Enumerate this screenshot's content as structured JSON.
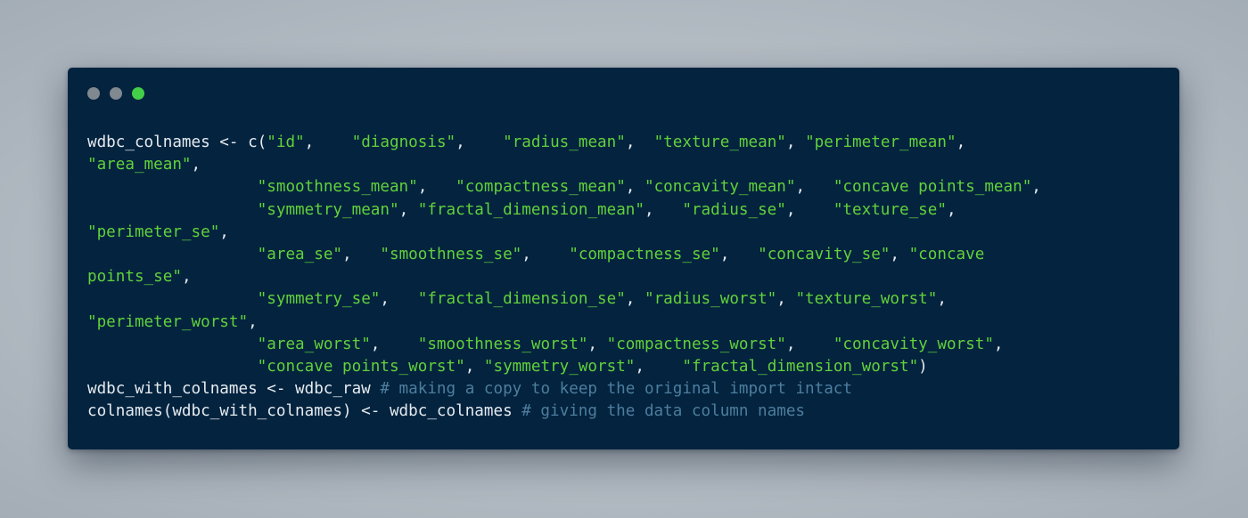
{
  "window": {
    "background": "#03233f",
    "buttons": [
      {
        "name": "close",
        "color": "#808890"
      },
      {
        "name": "minimize",
        "color": "#808890"
      },
      {
        "name": "maximize",
        "color": "#43cf47"
      }
    ]
  },
  "colors": {
    "plain": "#e6ebef",
    "string": "#62d13a",
    "comment": "#4d7e9e"
  },
  "code_lines": [
    [
      {
        "t": "plain",
        "v": "wdbc_colnames <- c("
      },
      {
        "t": "string",
        "v": "\"id\""
      },
      {
        "t": "plain",
        "v": ",    "
      },
      {
        "t": "string",
        "v": "\"diagnosis\""
      },
      {
        "t": "plain",
        "v": ",    "
      },
      {
        "t": "string",
        "v": "\"radius_mean\""
      },
      {
        "t": "plain",
        "v": ",  "
      },
      {
        "t": "string",
        "v": "\"texture_mean\""
      },
      {
        "t": "plain",
        "v": ", "
      },
      {
        "t": "string",
        "v": "\"perimeter_mean\""
      },
      {
        "t": "plain",
        "v": ","
      }
    ],
    [
      {
        "t": "string",
        "v": "\"area_mean\""
      },
      {
        "t": "plain",
        "v": ","
      }
    ],
    [
      {
        "t": "plain",
        "v": "                  "
      },
      {
        "t": "string",
        "v": "\"smoothness_mean\""
      },
      {
        "t": "plain",
        "v": ",   "
      },
      {
        "t": "string",
        "v": "\"compactness_mean\""
      },
      {
        "t": "plain",
        "v": ", "
      },
      {
        "t": "string",
        "v": "\"concavity_mean\""
      },
      {
        "t": "plain",
        "v": ",   "
      },
      {
        "t": "string",
        "v": "\"concave points_mean\""
      },
      {
        "t": "plain",
        "v": ","
      }
    ],
    [
      {
        "t": "plain",
        "v": "                  "
      },
      {
        "t": "string",
        "v": "\"symmetry_mean\""
      },
      {
        "t": "plain",
        "v": ", "
      },
      {
        "t": "string",
        "v": "\"fractal_dimension_mean\""
      },
      {
        "t": "plain",
        "v": ",   "
      },
      {
        "t": "string",
        "v": "\"radius_se\""
      },
      {
        "t": "plain",
        "v": ",    "
      },
      {
        "t": "string",
        "v": "\"texture_se\""
      },
      {
        "t": "plain",
        "v": ","
      }
    ],
    [
      {
        "t": "string",
        "v": "\"perimeter_se\""
      },
      {
        "t": "plain",
        "v": ","
      }
    ],
    [
      {
        "t": "plain",
        "v": "                  "
      },
      {
        "t": "string",
        "v": "\"area_se\""
      },
      {
        "t": "plain",
        "v": ",   "
      },
      {
        "t": "string",
        "v": "\"smoothness_se\""
      },
      {
        "t": "plain",
        "v": ",    "
      },
      {
        "t": "string",
        "v": "\"compactness_se\""
      },
      {
        "t": "plain",
        "v": ",   "
      },
      {
        "t": "string",
        "v": "\"concavity_se\""
      },
      {
        "t": "plain",
        "v": ", "
      },
      {
        "t": "string",
        "v": "\"concave"
      }
    ],
    [
      {
        "t": "string",
        "v": "points_se\""
      },
      {
        "t": "plain",
        "v": ","
      }
    ],
    [
      {
        "t": "plain",
        "v": "                  "
      },
      {
        "t": "string",
        "v": "\"symmetry_se\""
      },
      {
        "t": "plain",
        "v": ",   "
      },
      {
        "t": "string",
        "v": "\"fractal_dimension_se\""
      },
      {
        "t": "plain",
        "v": ", "
      },
      {
        "t": "string",
        "v": "\"radius_worst\""
      },
      {
        "t": "plain",
        "v": ", "
      },
      {
        "t": "string",
        "v": "\"texture_worst\""
      },
      {
        "t": "plain",
        "v": ","
      }
    ],
    [
      {
        "t": "string",
        "v": "\"perimeter_worst\""
      },
      {
        "t": "plain",
        "v": ","
      }
    ],
    [
      {
        "t": "plain",
        "v": "                  "
      },
      {
        "t": "string",
        "v": "\"area_worst\""
      },
      {
        "t": "plain",
        "v": ",    "
      },
      {
        "t": "string",
        "v": "\"smoothness_worst\""
      },
      {
        "t": "plain",
        "v": ", "
      },
      {
        "t": "string",
        "v": "\"compactness_worst\""
      },
      {
        "t": "plain",
        "v": ",    "
      },
      {
        "t": "string",
        "v": "\"concavity_worst\""
      },
      {
        "t": "plain",
        "v": ","
      }
    ],
    [
      {
        "t": "plain",
        "v": "                  "
      },
      {
        "t": "string",
        "v": "\"concave points_worst\""
      },
      {
        "t": "plain",
        "v": ", "
      },
      {
        "t": "string",
        "v": "\"symmetry_worst\""
      },
      {
        "t": "plain",
        "v": ",    "
      },
      {
        "t": "string",
        "v": "\"fractal_dimension_worst\""
      },
      {
        "t": "plain",
        "v": ")"
      }
    ],
    [
      {
        "t": "plain",
        "v": "wdbc_with_colnames <- wdbc_raw "
      },
      {
        "t": "comment",
        "v": "# making a copy to keep the original import intact"
      }
    ],
    [
      {
        "t": "plain",
        "v": "colnames(wdbc_with_colnames) <- wdbc_colnames "
      },
      {
        "t": "comment",
        "v": "# giving the data column names"
      }
    ]
  ]
}
